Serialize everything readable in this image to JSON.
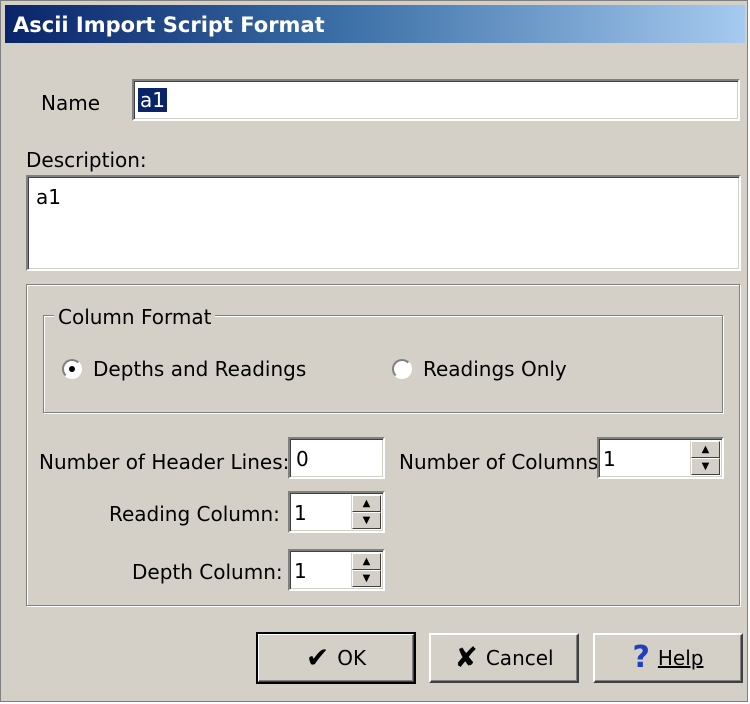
{
  "window": {
    "title": "Ascii Import Script Format"
  },
  "name": {
    "label": "Name",
    "value": "a1"
  },
  "description": {
    "label": "Description:",
    "value": "a1"
  },
  "column_format": {
    "legend": "Column Format",
    "options": [
      {
        "label": "Depths and Readings",
        "selected": true
      },
      {
        "label": "Readings Only",
        "selected": false
      }
    ]
  },
  "header_lines": {
    "label": "Number of Header Lines:",
    "value": "0"
  },
  "num_columns": {
    "label": "Number of Columns:",
    "value": "1"
  },
  "reading_column": {
    "label": "Reading Column:",
    "value": "1"
  },
  "depth_column": {
    "label": "Depth Column:",
    "value": "1"
  },
  "buttons": {
    "ok": "OK",
    "cancel": "Cancel",
    "help": "Help"
  },
  "icons": {
    "ok": "check-icon",
    "cancel": "x-icon",
    "help": "question-icon"
  },
  "colors": {
    "ok_icon": "#000000",
    "cancel_icon": "#000000",
    "help_icon": "#1f3fbf",
    "selection": "#0a246a"
  }
}
